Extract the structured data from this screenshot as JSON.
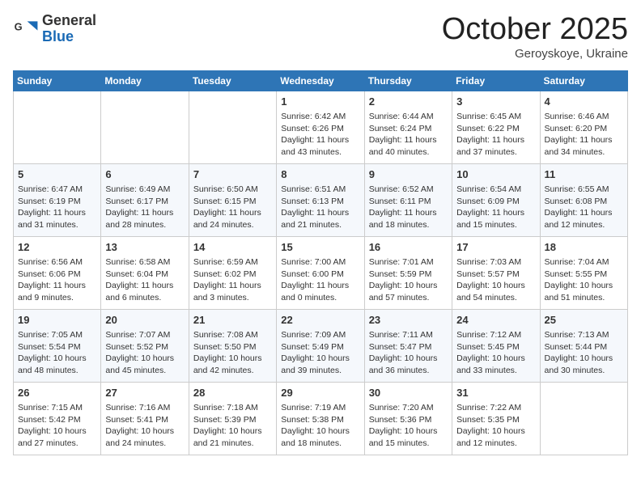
{
  "header": {
    "logo_general": "General",
    "logo_blue": "Blue",
    "month_title": "October 2025",
    "location": "Geroyskoye, Ukraine"
  },
  "weekdays": [
    "Sunday",
    "Monday",
    "Tuesday",
    "Wednesday",
    "Thursday",
    "Friday",
    "Saturday"
  ],
  "weeks": [
    [
      {
        "day": "",
        "info": ""
      },
      {
        "day": "",
        "info": ""
      },
      {
        "day": "",
        "info": ""
      },
      {
        "day": "1",
        "info": "Sunrise: 6:42 AM\nSunset: 6:26 PM\nDaylight: 11 hours and 43 minutes."
      },
      {
        "day": "2",
        "info": "Sunrise: 6:44 AM\nSunset: 6:24 PM\nDaylight: 11 hours and 40 minutes."
      },
      {
        "day": "3",
        "info": "Sunrise: 6:45 AM\nSunset: 6:22 PM\nDaylight: 11 hours and 37 minutes."
      },
      {
        "day": "4",
        "info": "Sunrise: 6:46 AM\nSunset: 6:20 PM\nDaylight: 11 hours and 34 minutes."
      }
    ],
    [
      {
        "day": "5",
        "info": "Sunrise: 6:47 AM\nSunset: 6:19 PM\nDaylight: 11 hours and 31 minutes."
      },
      {
        "day": "6",
        "info": "Sunrise: 6:49 AM\nSunset: 6:17 PM\nDaylight: 11 hours and 28 minutes."
      },
      {
        "day": "7",
        "info": "Sunrise: 6:50 AM\nSunset: 6:15 PM\nDaylight: 11 hours and 24 minutes."
      },
      {
        "day": "8",
        "info": "Sunrise: 6:51 AM\nSunset: 6:13 PM\nDaylight: 11 hours and 21 minutes."
      },
      {
        "day": "9",
        "info": "Sunrise: 6:52 AM\nSunset: 6:11 PM\nDaylight: 11 hours and 18 minutes."
      },
      {
        "day": "10",
        "info": "Sunrise: 6:54 AM\nSunset: 6:09 PM\nDaylight: 11 hours and 15 minutes."
      },
      {
        "day": "11",
        "info": "Sunrise: 6:55 AM\nSunset: 6:08 PM\nDaylight: 11 hours and 12 minutes."
      }
    ],
    [
      {
        "day": "12",
        "info": "Sunrise: 6:56 AM\nSunset: 6:06 PM\nDaylight: 11 hours and 9 minutes."
      },
      {
        "day": "13",
        "info": "Sunrise: 6:58 AM\nSunset: 6:04 PM\nDaylight: 11 hours and 6 minutes."
      },
      {
        "day": "14",
        "info": "Sunrise: 6:59 AM\nSunset: 6:02 PM\nDaylight: 11 hours and 3 minutes."
      },
      {
        "day": "15",
        "info": "Sunrise: 7:00 AM\nSunset: 6:00 PM\nDaylight: 11 hours and 0 minutes."
      },
      {
        "day": "16",
        "info": "Sunrise: 7:01 AM\nSunset: 5:59 PM\nDaylight: 10 hours and 57 minutes."
      },
      {
        "day": "17",
        "info": "Sunrise: 7:03 AM\nSunset: 5:57 PM\nDaylight: 10 hours and 54 minutes."
      },
      {
        "day": "18",
        "info": "Sunrise: 7:04 AM\nSunset: 5:55 PM\nDaylight: 10 hours and 51 minutes."
      }
    ],
    [
      {
        "day": "19",
        "info": "Sunrise: 7:05 AM\nSunset: 5:54 PM\nDaylight: 10 hours and 48 minutes."
      },
      {
        "day": "20",
        "info": "Sunrise: 7:07 AM\nSunset: 5:52 PM\nDaylight: 10 hours and 45 minutes."
      },
      {
        "day": "21",
        "info": "Sunrise: 7:08 AM\nSunset: 5:50 PM\nDaylight: 10 hours and 42 minutes."
      },
      {
        "day": "22",
        "info": "Sunrise: 7:09 AM\nSunset: 5:49 PM\nDaylight: 10 hours and 39 minutes."
      },
      {
        "day": "23",
        "info": "Sunrise: 7:11 AM\nSunset: 5:47 PM\nDaylight: 10 hours and 36 minutes."
      },
      {
        "day": "24",
        "info": "Sunrise: 7:12 AM\nSunset: 5:45 PM\nDaylight: 10 hours and 33 minutes."
      },
      {
        "day": "25",
        "info": "Sunrise: 7:13 AM\nSunset: 5:44 PM\nDaylight: 10 hours and 30 minutes."
      }
    ],
    [
      {
        "day": "26",
        "info": "Sunrise: 7:15 AM\nSunset: 5:42 PM\nDaylight: 10 hours and 27 minutes."
      },
      {
        "day": "27",
        "info": "Sunrise: 7:16 AM\nSunset: 5:41 PM\nDaylight: 10 hours and 24 minutes."
      },
      {
        "day": "28",
        "info": "Sunrise: 7:18 AM\nSunset: 5:39 PM\nDaylight: 10 hours and 21 minutes."
      },
      {
        "day": "29",
        "info": "Sunrise: 7:19 AM\nSunset: 5:38 PM\nDaylight: 10 hours and 18 minutes."
      },
      {
        "day": "30",
        "info": "Sunrise: 7:20 AM\nSunset: 5:36 PM\nDaylight: 10 hours and 15 minutes."
      },
      {
        "day": "31",
        "info": "Sunrise: 7:22 AM\nSunset: 5:35 PM\nDaylight: 10 hours and 12 minutes."
      },
      {
        "day": "",
        "info": ""
      }
    ]
  ]
}
